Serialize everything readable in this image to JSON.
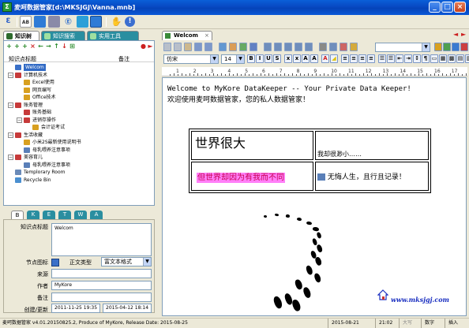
{
  "window": {
    "title": "麦呵数据管家[d:\\MKSJGJ\\Vanna.mnb]",
    "controls": [
      "minimize",
      "maximize",
      "close"
    ]
  },
  "toolbar": {
    "icons": [
      "logo-icon",
      "note-icon",
      "data-icon",
      "tree-icon",
      "book-icon",
      "search-icon",
      "grid-icon",
      "hand-icon",
      "info-icon"
    ]
  },
  "left_tabs": [
    {
      "label": "知识树",
      "color": "#2e6b2e"
    },
    {
      "label": "知识搜索",
      "color": "#2a8ea0"
    },
    {
      "label": "实用工具",
      "color": "#2a8ea0"
    }
  ],
  "tree": {
    "col_title": "知识点标题",
    "col_note": "备注",
    "items": [
      {
        "label": "Welcom",
        "level": 1,
        "selected": true,
        "icon": "#3a70c8"
      },
      {
        "label": "计算机技术",
        "level": 1,
        "icon": "#c63a3a"
      },
      {
        "label": "Excel使用",
        "level": 2,
        "icon": "#d8a020"
      },
      {
        "label": "网页编写",
        "level": 2,
        "icon": "#d8a020"
      },
      {
        "label": "Office技术",
        "level": 2,
        "icon": "#d8a020"
      },
      {
        "label": "账务管理",
        "level": 1,
        "icon": "#c63a3a"
      },
      {
        "label": "账务基础",
        "level": 2,
        "icon": "#c63a3a"
      },
      {
        "label": "进销存操作",
        "level": 2,
        "icon": "#c63a3a"
      },
      {
        "label": "会计证考试",
        "level": 3,
        "icon": "#d8a020"
      },
      {
        "label": "生活收藏",
        "level": 1,
        "icon": "#c63a3a"
      },
      {
        "label": "小米2S最新使用说明书",
        "level": 2,
        "icon": "#d8a020"
      },
      {
        "label": "母乳喂养注意事项",
        "level": 2,
        "icon": "#5a7fb8"
      },
      {
        "label": "美容育儿",
        "level": 1,
        "icon": "#c63a3a"
      },
      {
        "label": "母乳喂养注意事项",
        "level": 2,
        "icon": "#5a7fb8"
      },
      {
        "label": "Templorary Room",
        "level": 1,
        "icon": "#6a8ab8"
      },
      {
        "label": "Recycle Bin",
        "level": 1,
        "icon": "#4a8fd0"
      }
    ]
  },
  "letter_tabs": [
    "B",
    "K",
    "E",
    "T",
    "W",
    "A"
  ],
  "props": {
    "title_label": "知识点标题",
    "title_value": "Welcom",
    "icon_label": "节点图标",
    "type_label": "正文类型",
    "type_value": "富文本格式",
    "source_label": "来源",
    "source_value": "",
    "author_label": "作者",
    "author_value": "MyKore",
    "note_label": "备注",
    "note_value": "",
    "dates_label": "创建/更新",
    "created": "2011-11-25 19:35",
    "updated": "2015-04-12 18:14"
  },
  "doc_tab": {
    "label": "Welcom"
  },
  "format": {
    "font": "仿宋",
    "size": "14"
  },
  "ruler_marks": [
    "1",
    "2",
    "3",
    "4",
    "5",
    "6",
    "7",
    "8",
    "9",
    "10",
    "11",
    "12",
    "13",
    "14",
    "15",
    "16",
    "17"
  ],
  "doc": {
    "line1": "Welcome to MyKore DataKeeper -- Your Private Data Keeper!",
    "line2": "欢迎使用麦呵数据管家，您的私人数据管家！",
    "table": {
      "c11": "世界很大",
      "c12": "我却很渺小……",
      "c21": "但世界却因为有我而不同",
      "c22": "无悔人生，且行且记录！"
    },
    "link": "www.mksjgj.com",
    "colors": {
      "highlight": "#ff7ff8",
      "highlight_text": "#c80050",
      "link": "#1a2fc0"
    }
  },
  "status": {
    "left": "麦呵数据管家 v4.01.20150825.2, Produce of MyKore, Release Date: 2015-08-25",
    "date": "2015-08-21",
    "time": "21:02",
    "caps": "大写",
    "num": "数字",
    "ins": "插入"
  }
}
